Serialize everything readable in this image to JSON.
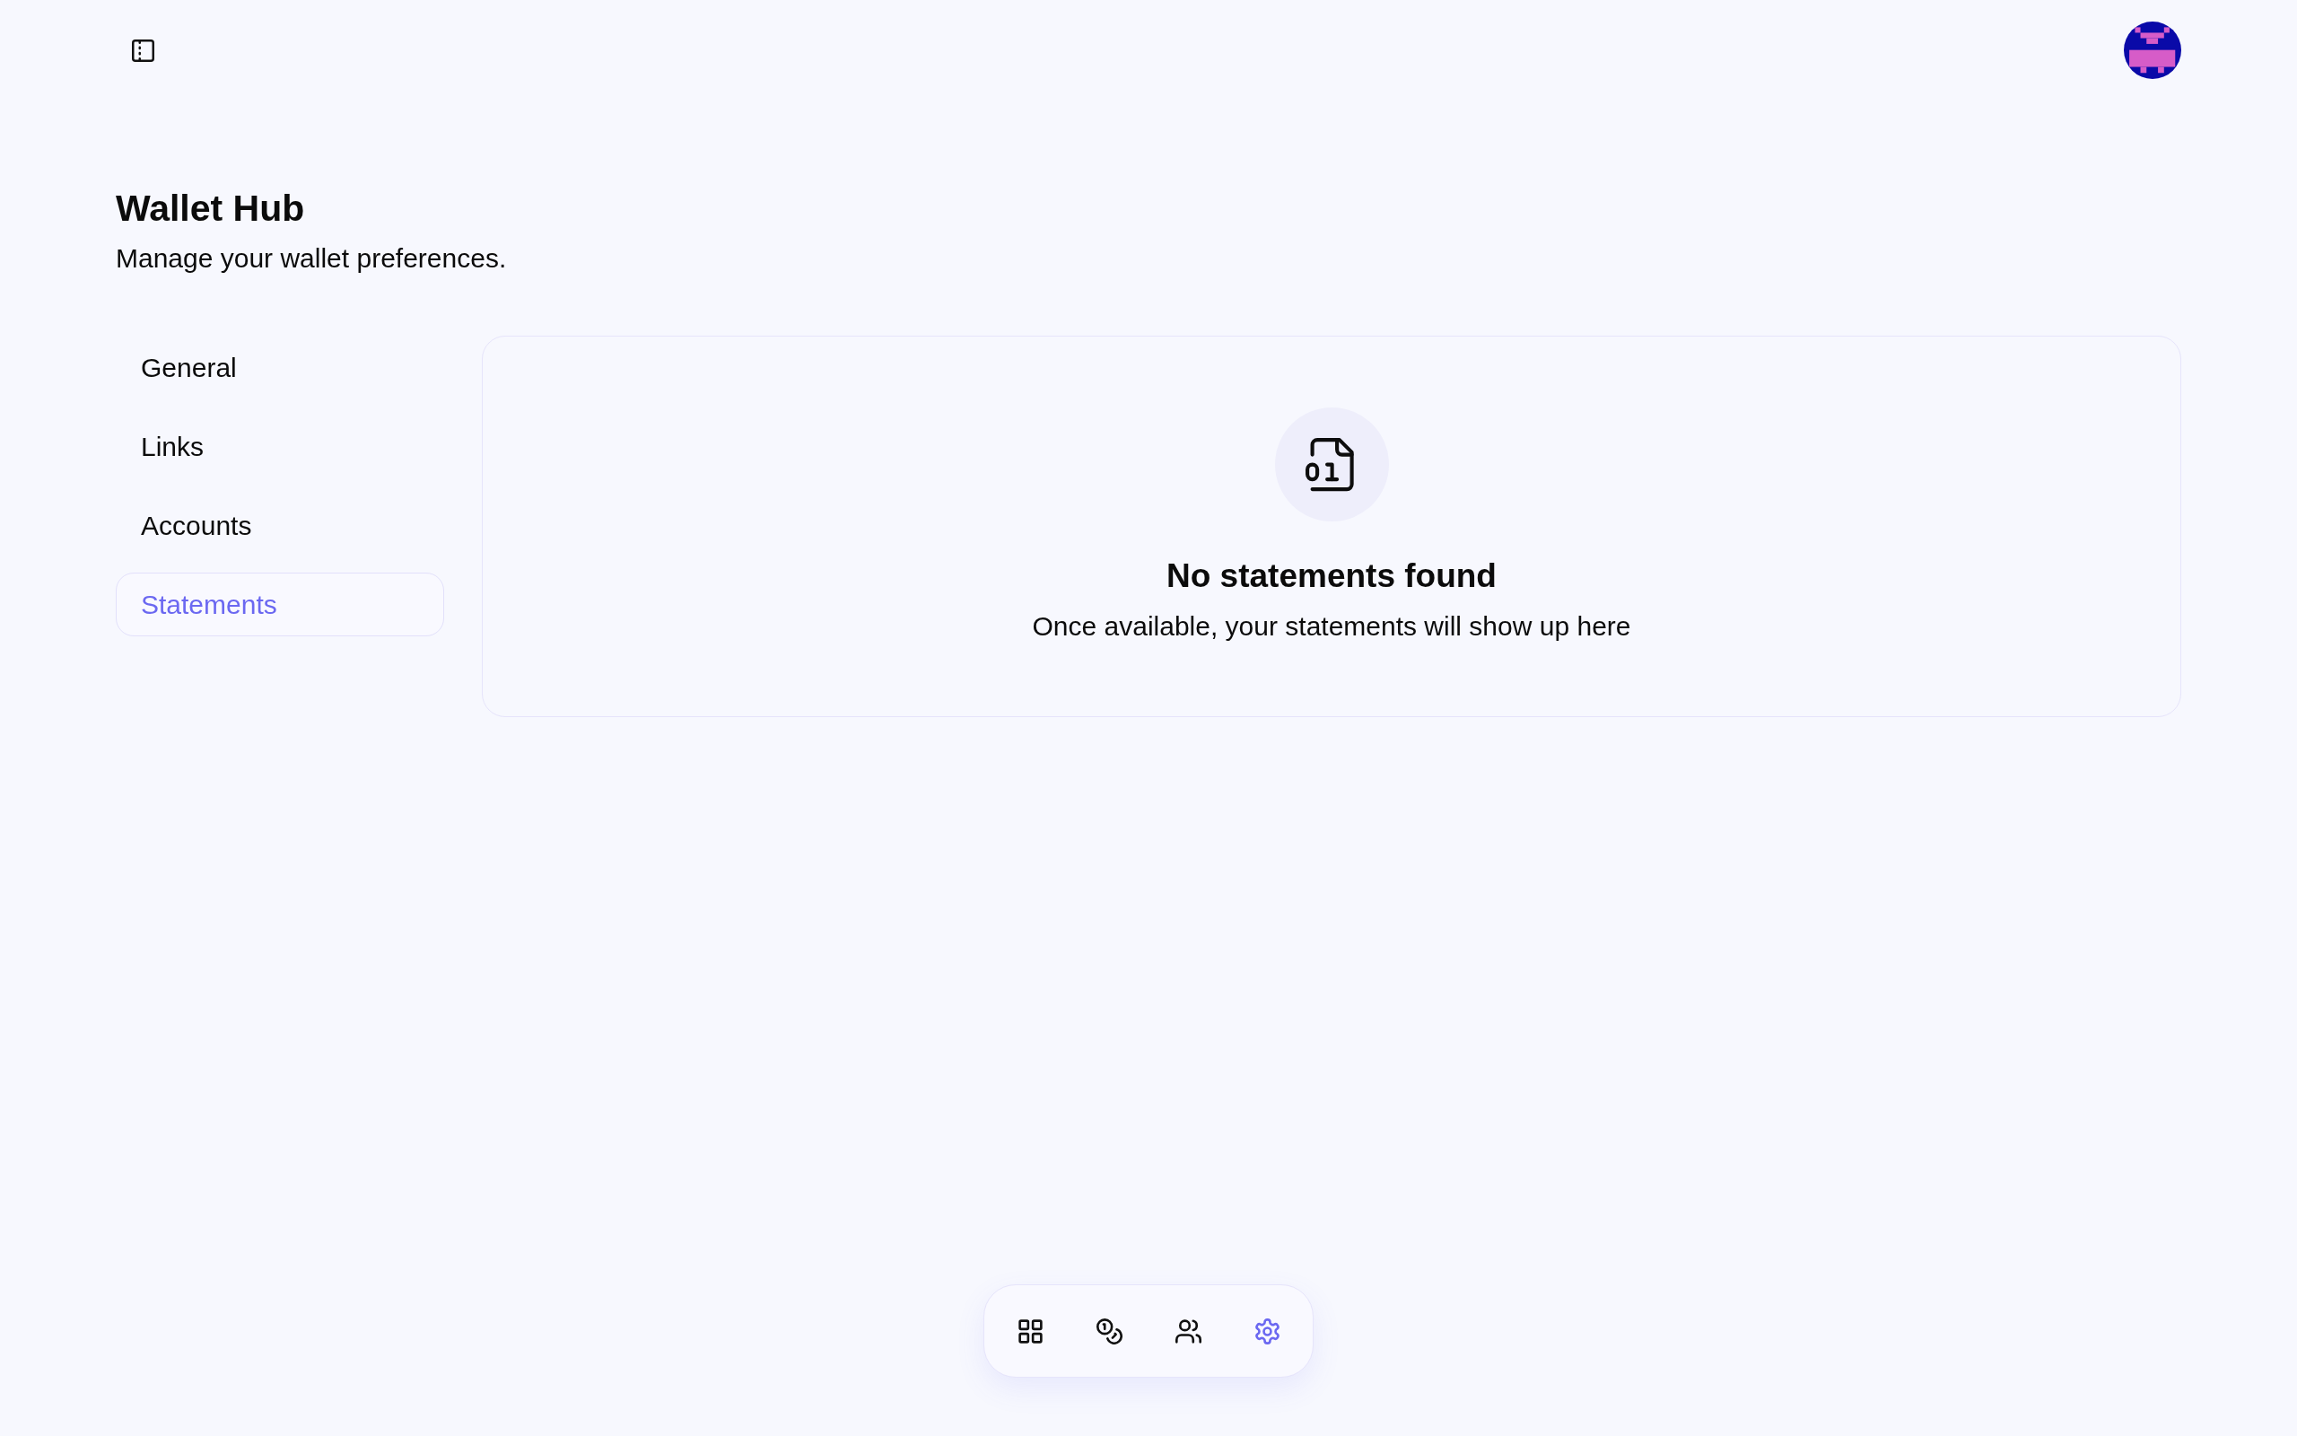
{
  "page": {
    "title": "Wallet Hub",
    "subtitle": "Manage your wallet preferences."
  },
  "settings_nav": {
    "items": [
      {
        "label": "General",
        "selected": false
      },
      {
        "label": "Links",
        "selected": false
      },
      {
        "label": "Accounts",
        "selected": false
      },
      {
        "label": "Statements",
        "selected": true
      }
    ]
  },
  "empty_state": {
    "title": "No statements found",
    "message": "Once available, your statements will show up here"
  },
  "dock": {
    "items": [
      {
        "kind": "grid",
        "selected": false
      },
      {
        "kind": "coins",
        "selected": false
      },
      {
        "kind": "users",
        "selected": false
      },
      {
        "kind": "settings",
        "selected": true
      }
    ]
  }
}
